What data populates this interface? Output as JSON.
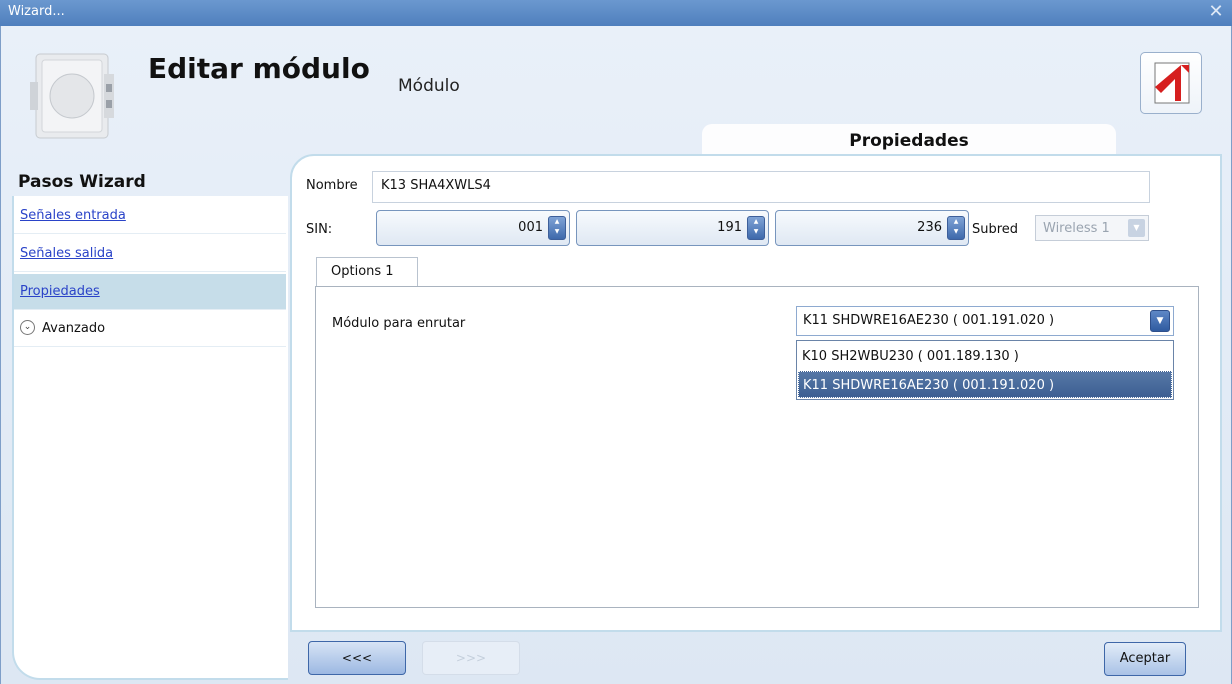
{
  "window": {
    "title": "Wizard...",
    "close_glyph": "✕"
  },
  "header": {
    "title": "Editar módulo",
    "subtitle": "Módulo",
    "tab_label": "Propiedades"
  },
  "sidebar": {
    "title": "Pasos Wizard",
    "items": [
      {
        "label": "Señales entrada"
      },
      {
        "label": "Señales salida"
      },
      {
        "label": "Propiedades",
        "selected": true
      },
      {
        "label": "Avanzado",
        "expander_glyph": "⌄"
      }
    ]
  },
  "form": {
    "nombre_label": "Nombre",
    "nombre_value": "K13 SHA4XWLS4",
    "sin_label": "SIN:",
    "sin": [
      "001",
      "191",
      "236"
    ],
    "subred_label": "Subred",
    "subred_value": "Wireless 1"
  },
  "options_tab": {
    "label": "Options 1"
  },
  "route": {
    "label": "Módulo para enrutar",
    "selected": "K11 SHDWRE16AE230  ( 001.191.020 )",
    "options": [
      "K10 SH2WBU230  ( 001.189.130 )",
      "K11 SHDWRE16AE230  ( 001.191.020 )"
    ]
  },
  "footer": {
    "back_label": "<<<",
    "next_label": ">>>",
    "accept_label": "Aceptar"
  },
  "colors": {
    "title_bar": "#5b8ac6",
    "link": "#2a43c8",
    "selection": "#4a6c9e",
    "sidebar_selected": "#c6dde9"
  },
  "icons": [
    "close-icon",
    "device-thumbnail",
    "app-logo-icon",
    "spin-up-down-icon",
    "dropdown-arrow-icon",
    "expand-icon"
  ]
}
